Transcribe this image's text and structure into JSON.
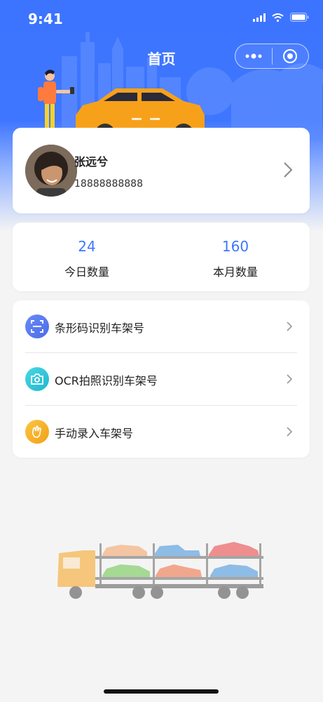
{
  "status_bar": {
    "time": "9:41"
  },
  "nav": {
    "title": "首页"
  },
  "profile": {
    "name": "张远兮",
    "phone": "18888888888"
  },
  "stats": [
    {
      "value": "24",
      "label": "今日数量"
    },
    {
      "value": "160",
      "label": "本月数量"
    }
  ],
  "menu": [
    {
      "label": "条形码识别车架号",
      "icon": "barcode-scan-icon",
      "color": "#5b7cf5"
    },
    {
      "label": "OCR拍照识别车架号",
      "icon": "camera-icon",
      "color": "#30c9d9"
    },
    {
      "label": "手动录入车架号",
      "icon": "hand-icon",
      "color": "#f8b628"
    }
  ],
  "colors": {
    "primary": "#3f76ff",
    "background": "#f4f4f4"
  }
}
